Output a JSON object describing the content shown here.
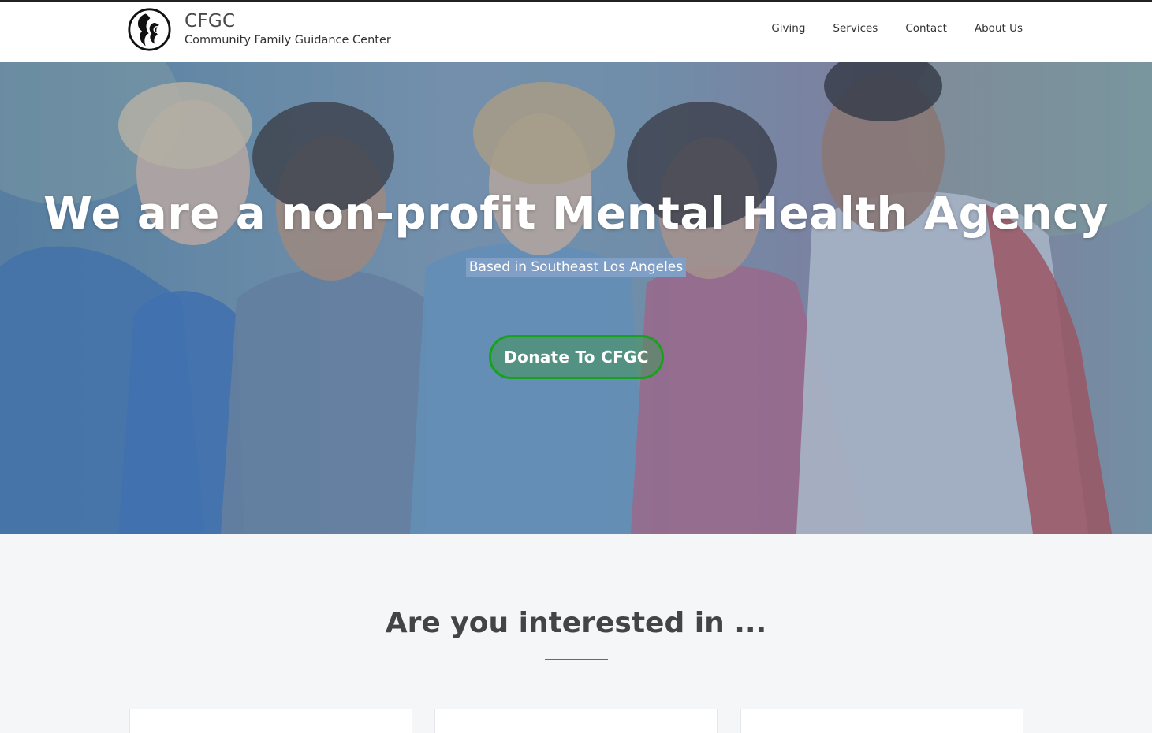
{
  "header": {
    "brand_title": "CFGC",
    "brand_subtitle": "Community Family Guidance Center",
    "nav": [
      {
        "label": "Giving"
      },
      {
        "label": "Services"
      },
      {
        "label": "Contact"
      },
      {
        "label": "About Us"
      }
    ]
  },
  "hero": {
    "title": "We are a non-profit Mental Health Agency",
    "subtitle": "Based in Southeast Los Angeles",
    "donate_label": "Donate To CFGC"
  },
  "section": {
    "title": "Are you interested in ..."
  },
  "colors": {
    "accent_green": "#16a21c",
    "divider_orange": "#b5531c",
    "highlight_blue": "#7f9fc6"
  }
}
